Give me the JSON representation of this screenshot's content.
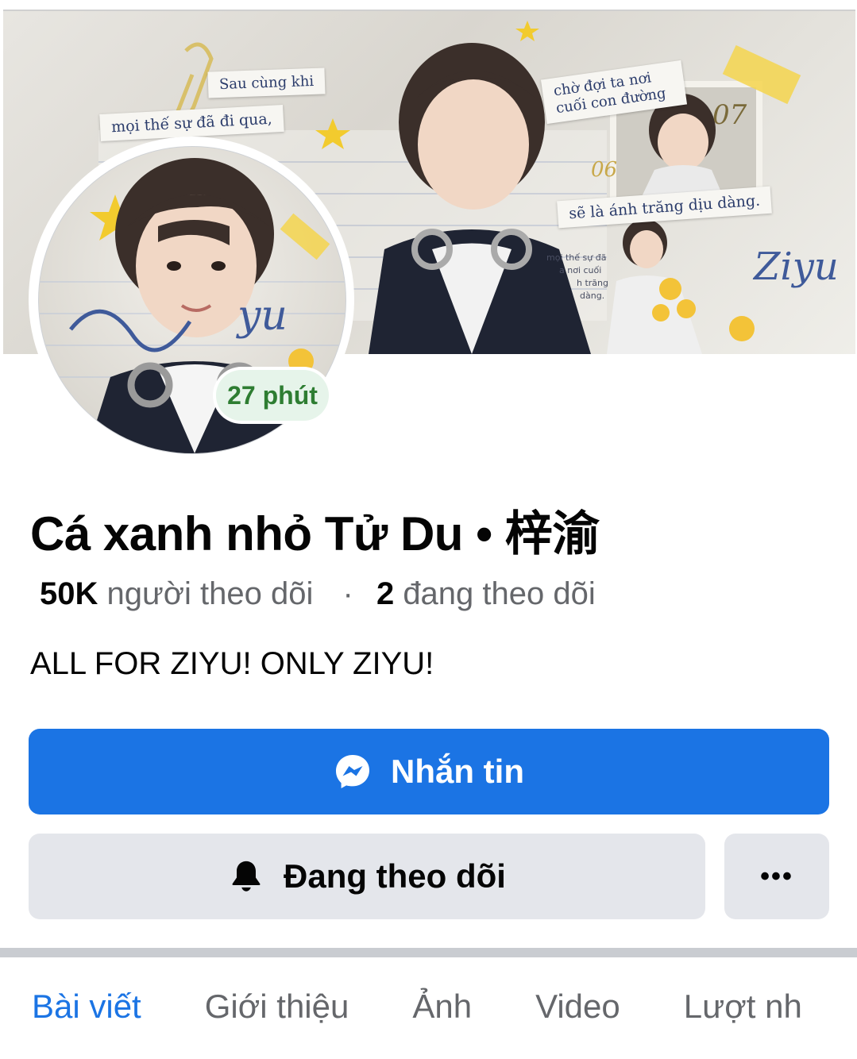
{
  "cover": {
    "captions": [
      "Sau cùng khi",
      "mọi thế sự đã đi qua,",
      "chờ đợi ta nơi cuối con đường",
      "sẽ là ánh trăng dịu dàng."
    ],
    "script_text": "Ziyu"
  },
  "profile": {
    "active_badge": "27 phút",
    "name": "Cá xanh nhỏ Tử Du • 梓渝",
    "followers_count": "50K",
    "followers_label": "người theo dõi",
    "following_count": "2",
    "following_label": "đang theo dõi",
    "bio": "ALL FOR ZIYU! ONLY ZIYU!"
  },
  "actions": {
    "message_label": "Nhắn tin",
    "following_label": "Đang theo dõi",
    "more_label": "•••"
  },
  "tabs": [
    {
      "label": "Bài viết",
      "active": true
    },
    {
      "label": "Giới thiệu",
      "active": false
    },
    {
      "label": "Ảnh",
      "active": false
    },
    {
      "label": "Video",
      "active": false
    },
    {
      "label": "Lượt nh",
      "active": false
    }
  ],
  "colors": {
    "primary": "#1b74e4",
    "secondary_bg": "#e4e6eb",
    "active_badge_text": "#2e7d32",
    "active_badge_bg": "#e6f4ea"
  },
  "icons": {
    "message": "messenger-icon",
    "following": "bell-icon",
    "more": "more-dots-icon"
  }
}
